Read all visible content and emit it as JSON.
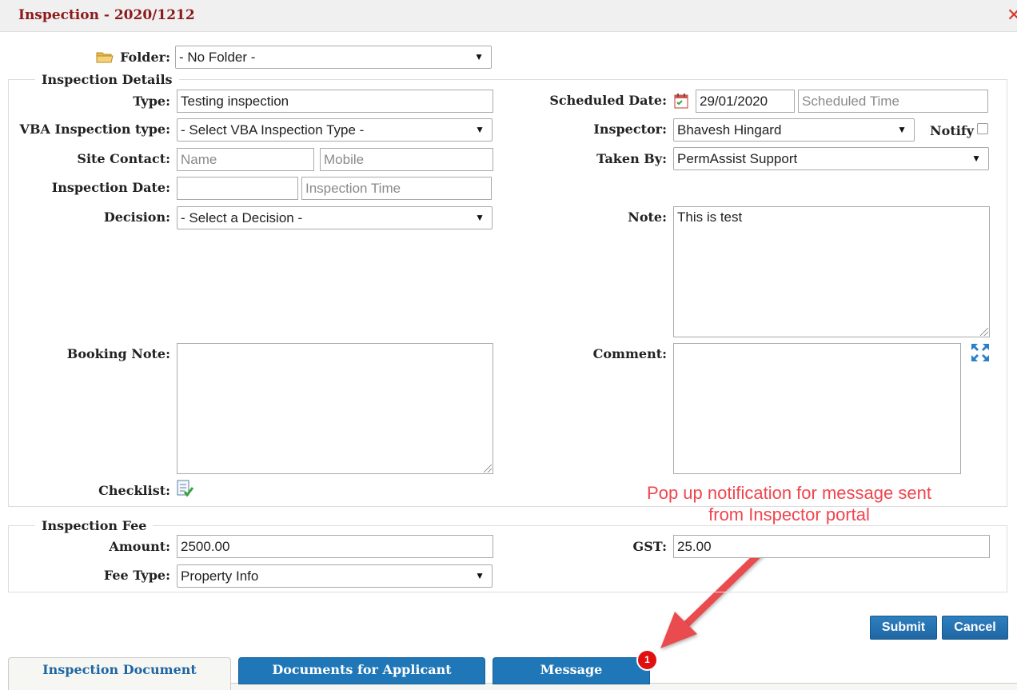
{
  "window": {
    "title": "Inspection - 2020/1212"
  },
  "folder": {
    "label": "Folder:",
    "value": "- No Folder -"
  },
  "details": {
    "legend": "Inspection Details",
    "type": {
      "label": "Type:",
      "value": "Testing inspection"
    },
    "vba": {
      "label": "VBA Inspection type:",
      "value": "- Select VBA Inspection Type -"
    },
    "site_contact": {
      "label": "Site Contact:",
      "name_placeholder": "Name",
      "mobile_placeholder": "Mobile"
    },
    "inspection_date": {
      "label": "Inspection Date:",
      "date_value": "",
      "time_placeholder": "Inspection Time"
    },
    "decision": {
      "label": "Decision:",
      "value": "- Select a Decision -"
    },
    "booking_note": {
      "label": "Booking Note:",
      "value": ""
    },
    "checklist": {
      "label": "Checklist:"
    },
    "scheduled": {
      "label": "Scheduled Date:",
      "date_value": "29/01/2020",
      "time_placeholder": "Scheduled Time"
    },
    "inspector": {
      "label": "Inspector:",
      "value": "Bhavesh Hingard"
    },
    "notify": {
      "label": "Notify",
      "checked": false
    },
    "taken_by": {
      "label": "Taken By:",
      "value": "PermAssist Support"
    },
    "note": {
      "label": "Note:",
      "value": "This is test"
    },
    "comment": {
      "label": "Comment:",
      "value": ""
    }
  },
  "fee": {
    "legend": "Inspection Fee",
    "amount": {
      "label": "Amount:",
      "value": "2500.00"
    },
    "fee_type": {
      "label": "Fee Type:",
      "value": "Property Info"
    },
    "gst": {
      "label": "GST:",
      "value": "25.00"
    }
  },
  "actions": {
    "submit": "Submit",
    "cancel": "Cancel"
  },
  "tabs": [
    {
      "label": "Inspection Document",
      "active": true
    },
    {
      "label": "Documents for Applicant",
      "active": false
    },
    {
      "label": "Message",
      "active": false,
      "badge": "1"
    }
  ],
  "annotation": {
    "line1": "Pop up notification for message sent",
    "line2": "from Inspector portal",
    "color": "#f0454e"
  },
  "colors": {
    "primary": "#1f77b8",
    "title": "#8b1a1a",
    "badge": "#e01010"
  },
  "icons": [
    "folder-icon",
    "calendar-icon",
    "checklist-icon",
    "expand-icon",
    "close-icon",
    "chevron-down-icon"
  ]
}
